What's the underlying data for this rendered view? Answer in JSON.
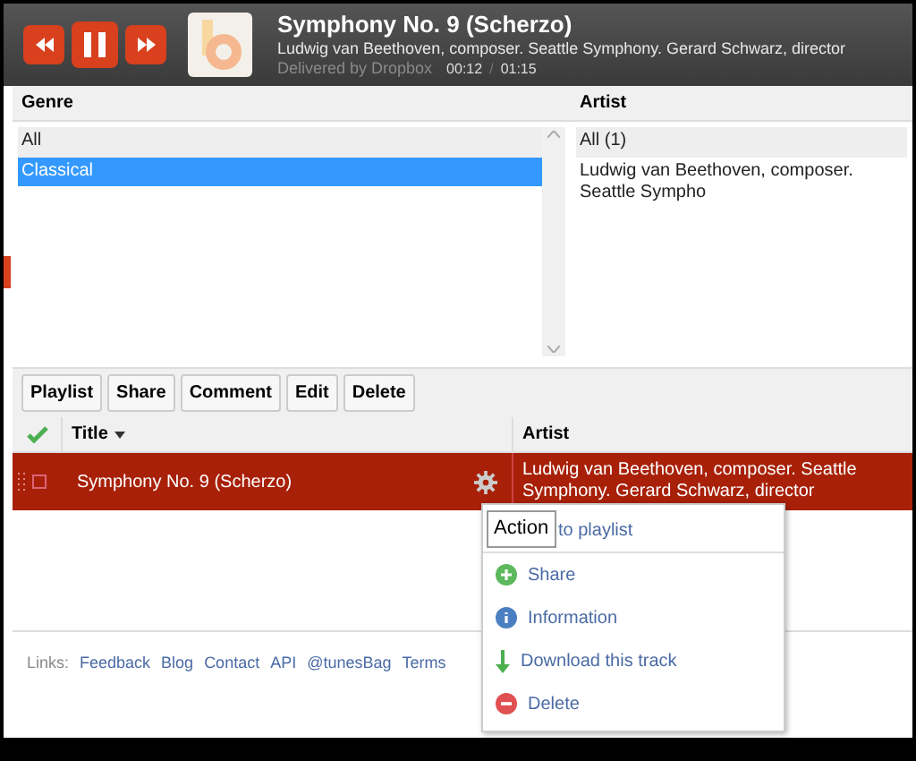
{
  "player": {
    "title": "Symphony No. 9 (Scherzo)",
    "artist": "Ludwig van Beethoven, composer. Seattle Symphony. Gerard Schwarz, director",
    "source": "Delivered by Dropbox",
    "elapsed": "00:12",
    "separator": "/",
    "duration": "01:15"
  },
  "genre": {
    "header": "Genre",
    "items": [
      {
        "label": "All",
        "selected": false
      },
      {
        "label": "Classical",
        "selected": true
      }
    ]
  },
  "artist": {
    "header": "Artist",
    "items": [
      {
        "label": "All (1)",
        "selected": false
      },
      {
        "label": "Ludwig van Beethoven, composer. Seattle Sympho",
        "selected": false
      }
    ]
  },
  "toolbar": [
    "Playlist",
    "Share",
    "Comment",
    "Edit",
    "Delete"
  ],
  "table": {
    "columns": [
      {
        "label": "Title",
        "sorted": true
      },
      {
        "label": "Artist",
        "sorted": false
      }
    ],
    "rows": [
      {
        "title": "Symphony No. 9 (Scherzo)",
        "artist": "Ludwig van Beethoven, composer. Seattle Symphony. Gerard Schwarz, director",
        "checked": false,
        "selected": true
      }
    ]
  },
  "menu": {
    "items": [
      {
        "label": "to playlist",
        "kind": "playlist"
      },
      {
        "label": "Share",
        "kind": "share"
      },
      {
        "label": "Information",
        "kind": "info"
      },
      {
        "label": "Download this track",
        "kind": "download"
      },
      {
        "label": "Delete",
        "kind": "delete"
      }
    ]
  },
  "tooltip": "Action",
  "footer": {
    "label": "Links:",
    "links": [
      "Feedback",
      "Blog",
      "Contact",
      "API",
      "@tunesBag",
      "Terms"
    ]
  }
}
